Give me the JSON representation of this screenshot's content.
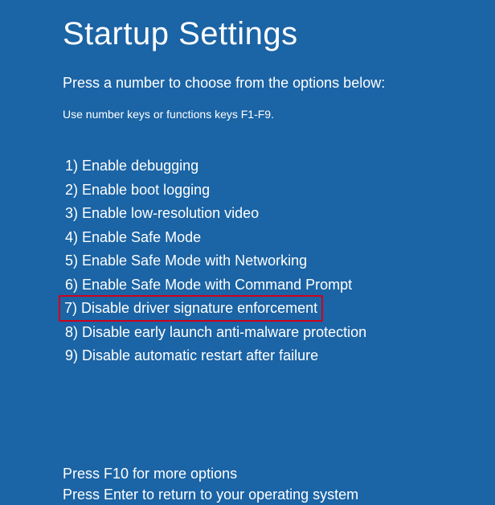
{
  "title": "Startup Settings",
  "subtitle": "Press a number to choose from the options below:",
  "hint": "Use number keys or functions keys F1-F9.",
  "options": [
    {
      "label": "1) Enable debugging",
      "highlighted": false
    },
    {
      "label": "2) Enable boot logging",
      "highlighted": false
    },
    {
      "label": "3) Enable low-resolution video",
      "highlighted": false
    },
    {
      "label": "4) Enable Safe Mode",
      "highlighted": false
    },
    {
      "label": "5) Enable Safe Mode with Networking",
      "highlighted": false
    },
    {
      "label": "6) Enable Safe Mode with Command Prompt",
      "highlighted": false
    },
    {
      "label": "7) Disable driver signature enforcement",
      "highlighted": true
    },
    {
      "label": "8) Disable early launch anti-malware protection",
      "highlighted": false
    },
    {
      "label": "9) Disable automatic restart after failure",
      "highlighted": false
    }
  ],
  "footer": {
    "more_options": "Press F10 for more options",
    "return_text": "Press Enter to return to your operating system"
  },
  "colors": {
    "background": "#1b64a5",
    "highlight_border": "#d0021b",
    "text": "#ffffff"
  }
}
